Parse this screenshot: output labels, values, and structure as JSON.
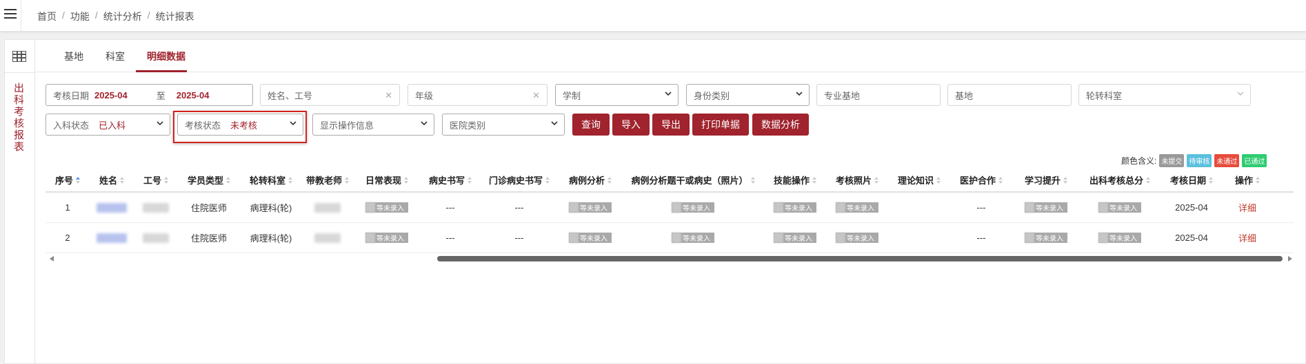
{
  "breadcrumb": [
    "首页",
    "功能",
    "统计分析",
    "统计报表"
  ],
  "sidebar": {
    "title": "出科考核报表"
  },
  "tabs": [
    "基地",
    "科室",
    "明细数据"
  ],
  "active_tab": "明细数据",
  "filters": {
    "date_label": "考核日期",
    "date_from": "2025-04",
    "date_to_sep": "至",
    "date_to": "2025-04",
    "name_placeholder": "姓名、工号",
    "grade_placeholder": "年级",
    "schooling": "学制",
    "identity": "身份类别",
    "major_base_placeholder": "专业基地",
    "base_placeholder": "基地",
    "rotation_dept_placeholder": "轮转科室",
    "entry_status_label": "入科状态",
    "entry_status_value": "已入科",
    "exam_status_label": "考核状态",
    "exam_status_value": "未考核",
    "show_ops": "显示操作信息",
    "hospital_type": "医院类别"
  },
  "buttons": {
    "query": "查询",
    "import": "导入",
    "export": "导出",
    "print": "打印单据",
    "analysis": "数据分析"
  },
  "legend": {
    "label": "颜色含义:",
    "items": [
      {
        "text": "未提交",
        "color": "#999999"
      },
      {
        "text": "待审核",
        "color": "#5bc0de"
      },
      {
        "text": "未通过",
        "color": "#e74c3c"
      },
      {
        "text": "已通过",
        "color": "#2ecc71"
      }
    ]
  },
  "table": {
    "headers": [
      "序号",
      "姓名",
      "工号",
      "学员类型",
      "轮转科室",
      "带教老师",
      "日常表现",
      "病史书写",
      "门诊病史书写",
      "病例分析",
      "病例分析题干或病史（照片）",
      "技能操作",
      "考核照片",
      "理论知识",
      "医护合作",
      "学习提升",
      "出科考核总分",
      "考核日期",
      "操作"
    ],
    "pending_text": "等未录入",
    "rows": [
      {
        "index": "1",
        "type": "住院医师",
        "dept": "病理科(轮)",
        "history": "---",
        "outpatient": "---",
        "nursing": "---",
        "date": "2025-04",
        "action": "详细"
      },
      {
        "index": "2",
        "type": "住院医师",
        "dept": "病理科(轮)",
        "history": "---",
        "outpatient": "---",
        "nursing": "---",
        "date": "2025-04",
        "action": "详细"
      }
    ]
  }
}
